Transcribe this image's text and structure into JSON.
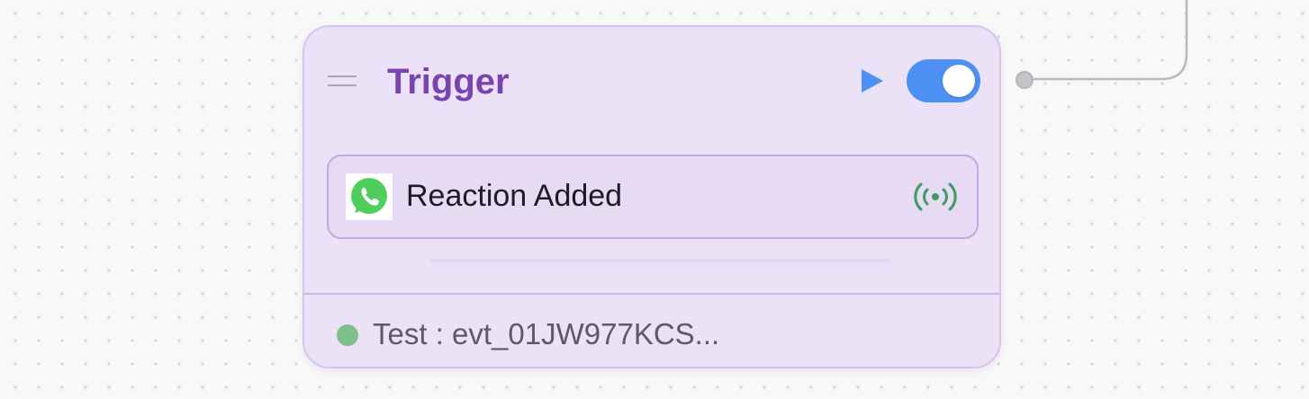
{
  "node": {
    "title": "Trigger",
    "enabled": true,
    "event": {
      "label": "Reaction Added",
      "app_icon": "whatsapp-icon",
      "status_icon": "broadcast-signal-icon"
    },
    "status": {
      "text": "Test : evt_01JW977KCS...",
      "dot_color": "#7fbf8a"
    }
  },
  "colors": {
    "title": "#7a44b0",
    "toggle_on": "#4d8ff2",
    "play": "#4d8ff2",
    "whatsapp": "#4fce5d",
    "signal": "#3f9a62",
    "node_bg": "#ece2f8",
    "node_border": "#d6c4ee"
  }
}
